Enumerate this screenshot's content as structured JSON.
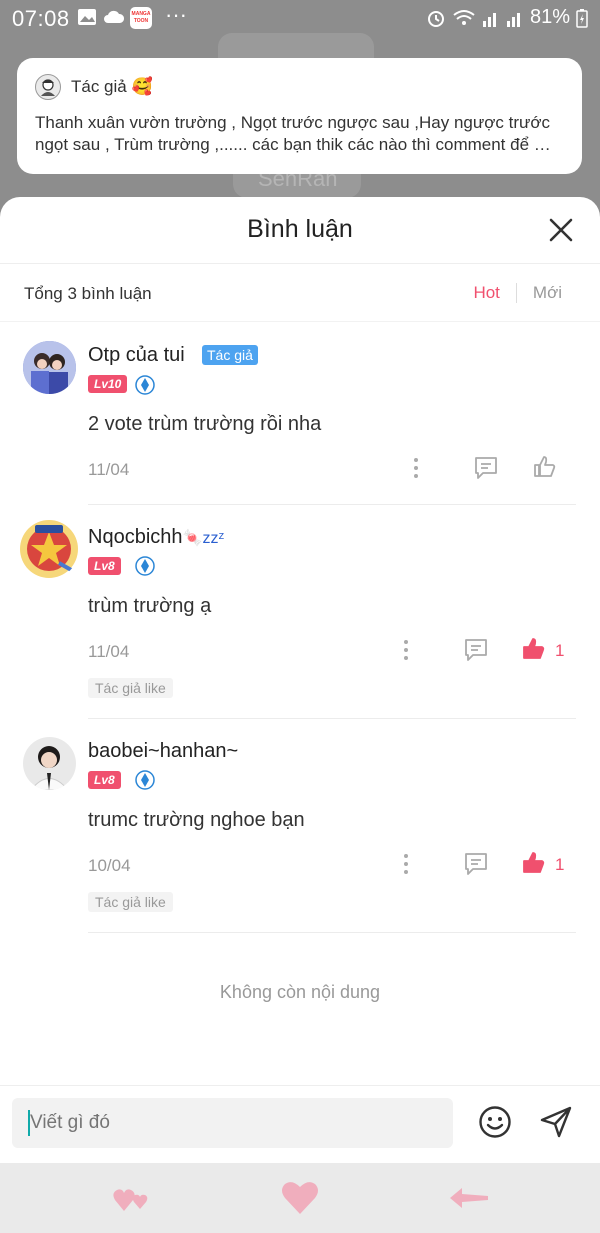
{
  "status_bar": {
    "time": "07:08",
    "battery": "81%",
    "app_badge": "MANGA TOON"
  },
  "background": {
    "chapter_author": "SenRan"
  },
  "author_note": {
    "label": "Tác giả",
    "emoji": "🥰",
    "text": "Thanh xuân vườn trường , Ngọt trước ngược sau ,Hay ngược trước ngọt sau , Trùm trường ,...... các bạn thik các nào thì comment  để …"
  },
  "sheet": {
    "title": "Bình luận",
    "total": "Tổng 3 bình luận",
    "sort_hot": "Hot",
    "sort_new": "Mới"
  },
  "comments": [
    {
      "name": "Otp của tui",
      "tag": "Tác giả",
      "level": "Lv10",
      "text": "2 vote trùm trường rồi  nha",
      "date": "11/04",
      "likes": "",
      "liked_by_author": ""
    },
    {
      "name": "Nqocbichh",
      "name_deco": "🍬zzᶻ",
      "level": "Lv8",
      "text": "trùm trường ạ",
      "date": "11/04",
      "likes": "1",
      "liked_by_author": "Tác giả like"
    },
    {
      "name": "baobei~hanhan~",
      "level": "Lv8",
      "text": "trumc trường nghoe bạn",
      "date": "10/04",
      "likes": "1",
      "liked_by_author": "Tác giả like"
    }
  ],
  "end_text": "Không còn nội dung",
  "input": {
    "placeholder": "Viết gì đó"
  },
  "colors": {
    "accent": "#f0506e",
    "author_tag": "#4da3f0",
    "muted": "#999999"
  },
  "icons": {
    "close": "close-icon",
    "reply": "comment-icon",
    "like": "thumbs-up-icon",
    "more": "more-vertical-icon",
    "emoji": "smiley-icon",
    "send": "send-icon",
    "nav_like": "heart-icon",
    "nav_back": "arrow-left-icon"
  }
}
